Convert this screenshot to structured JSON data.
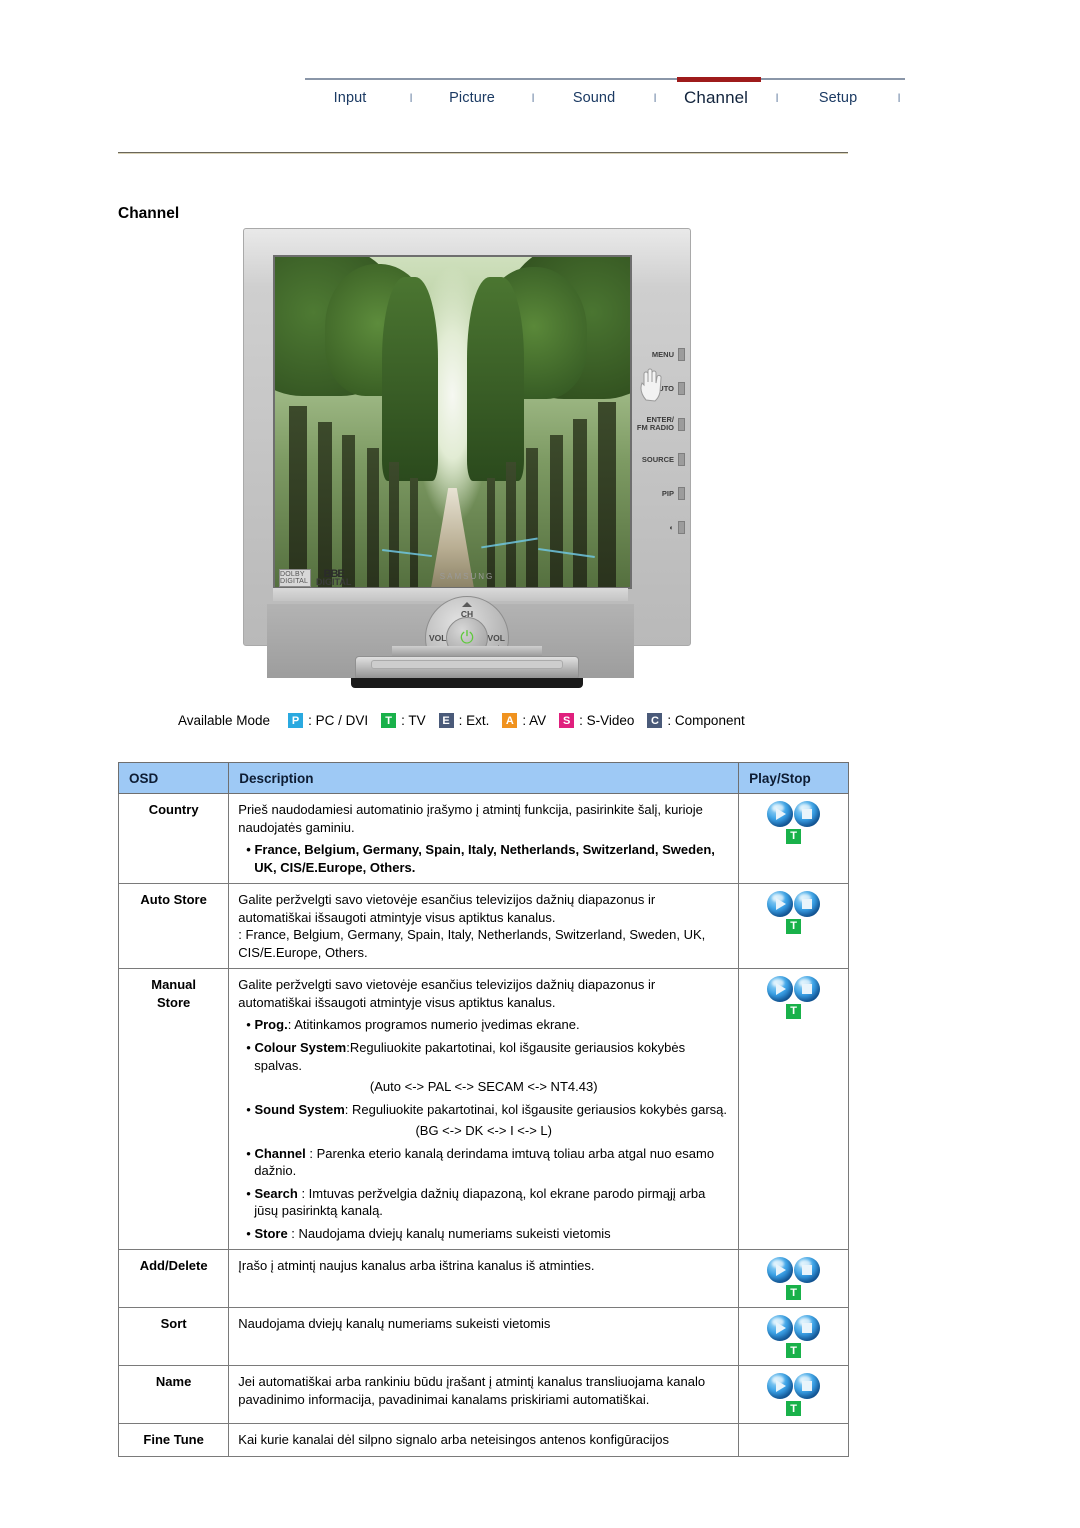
{
  "nav": {
    "tabs": [
      {
        "label": "Input",
        "active": false
      },
      {
        "label": "Picture",
        "active": false
      },
      {
        "label": "Sound",
        "active": false
      },
      {
        "label": "Channel",
        "active": true
      },
      {
        "label": "Setup",
        "active": false
      }
    ],
    "separator": "l",
    "active_accent": "#9e1b1b",
    "link_color": "#1b3a63"
  },
  "page": {
    "title": "Channel"
  },
  "device": {
    "controls": {
      "ch_up": "CH",
      "ch_down": "CH",
      "vol_left": "VOL",
      "vol_left_sign": "–",
      "vol_right": "VOL",
      "vol_right_sign": "+",
      "power": "⏻"
    },
    "brand": "SAMSUNG",
    "logos": {
      "dolby": "DOLBY DIGITAL",
      "bbe": "BBE",
      "bbe_sub": "DIGITAL"
    },
    "side_buttons": [
      "MENU",
      "AUTO",
      "ENTER/\nFM RADIO",
      "SOURCE",
      "PIP",
      "◐"
    ]
  },
  "available_mode": {
    "label": "Available Mode",
    "modes": [
      {
        "badge": "P",
        "color": "#2aa9e0",
        "text": ": PC / DVI"
      },
      {
        "badge": "T",
        "color": "#19b14a",
        "text": ": TV"
      },
      {
        "badge": "E",
        "color": "#4a5a79",
        "text": ": Ext."
      },
      {
        "badge": "A",
        "color": "#f0921e",
        "text": ": AV"
      },
      {
        "badge": "S",
        "color": "#e01f7d",
        "text": ": S-Video"
      },
      {
        "badge": "C",
        "color": "#4a5a79",
        "text": ": Component"
      }
    ]
  },
  "table": {
    "header_bg": "#9ec9f5",
    "headers": {
      "osd": "OSD",
      "description": "Description",
      "playstop": "Play/Stop"
    },
    "rows": [
      {
        "osd": "Country",
        "blocks": [
          {
            "kind": "p",
            "text": "Prieš naudodamiesi automatinio įrašymo į atmintį funkcija, pasirinkite šalį, kurioje naudojatės gaminiu."
          },
          {
            "kind": "bullet-bold",
            "text": "• France, Belgium, Germany, Spain, Italy, Netherlands, Switzerland, Sweden, UK, CIS/E.Europe, Others."
          }
        ],
        "playstop": true,
        "mode_badge": "T"
      },
      {
        "osd": "Auto Store",
        "blocks": [
          {
            "kind": "p",
            "text": "Galite peržvelgti savo vietovėje esančius televizijos dažnių diapazonus ir automatiškai išsaugoti atmintyje visus aptiktus kanalus."
          },
          {
            "kind": "p",
            "text": ": France, Belgium, Germany, Spain, Italy, Netherlands, Switzerland, Sweden, UK, CIS/E.Europe, Others."
          }
        ],
        "playstop": true,
        "mode_badge": "T"
      },
      {
        "osd": "Manual\nStore",
        "blocks": [
          {
            "kind": "p",
            "text": "Galite peržvelgti savo vietovėje esančius televizijos dažnių diapazonus ir automatiškai išsaugoti atmintyje visus aptiktus kanalus."
          },
          {
            "kind": "bullet",
            "lead": "Prog.",
            "text": ": Atitinkamos programos numerio įvedimas ekrane."
          },
          {
            "kind": "bullet",
            "lead": "Colour System",
            "text": ":Reguliuokite pakartotinai, kol išgausite geriausios kokybės spalvas."
          },
          {
            "kind": "center",
            "text": "(Auto <-> PAL <-> SECAM <-> NT4.43)"
          },
          {
            "kind": "bullet",
            "lead": "Sound System",
            "text": ": Reguliuokite pakartotinai, kol išgausite geriausios kokybės garsą."
          },
          {
            "kind": "center",
            "text": "(BG <-> DK <-> I <-> L)"
          },
          {
            "kind": "bullet",
            "lead": "Channel",
            "text": " : Parenka eterio kanalą derindama imtuvą toliau arba atgal nuo esamo dažnio."
          },
          {
            "kind": "bullet",
            "lead": "Search",
            "text": " : Imtuvas peržvelgia dažnių diapazoną, kol ekrane parodo pirmąjį arba jūsų pasirinktą kanalą."
          },
          {
            "kind": "bullet",
            "lead": "Store",
            "text": " : Naudojama dviejų kanalų numeriams sukeisti vietomis"
          }
        ],
        "playstop": true,
        "mode_badge": "T"
      },
      {
        "osd": "Add/Delete",
        "blocks": [
          {
            "kind": "p",
            "text": "Įrašo į atmintį naujus kanalus arba ištrina kanalus iš atminties."
          }
        ],
        "playstop": true,
        "mode_badge": "T"
      },
      {
        "osd": "Sort",
        "blocks": [
          {
            "kind": "p",
            "text": "Naudojama dviejų kanalų numeriams sukeisti vietomis"
          }
        ],
        "playstop": true,
        "mode_badge": "T"
      },
      {
        "osd": "Name",
        "blocks": [
          {
            "kind": "p",
            "text": "Jei automatiškai arba rankiniu būdu įrašant į atmintį kanalus transliuojama kanalo pavadinimo informacija, pavadinimai kanalams priskiriami automatiškai."
          }
        ],
        "playstop": true,
        "mode_badge": "T"
      },
      {
        "osd": "Fine Tune",
        "blocks": [
          {
            "kind": "p",
            "text": "Kai kurie kanalai dėl silpno signalo arba neteisingos antenos konfigūracijos"
          }
        ],
        "playstop": false,
        "mode_badge": ""
      }
    ]
  }
}
